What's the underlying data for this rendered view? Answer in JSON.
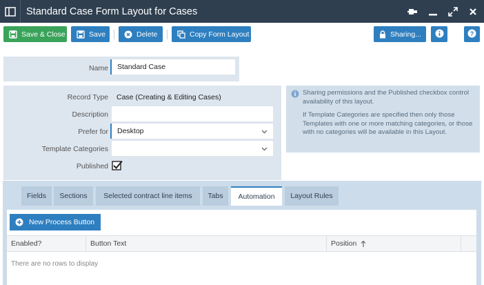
{
  "window": {
    "title": "Standard Case Form Layout for Cases"
  },
  "toolbar": {
    "save_close": "Save & Close",
    "save": "Save",
    "delete": "Delete",
    "copy_form_layout": "Copy Form Layout",
    "sharing": "Sharing..."
  },
  "form": {
    "name_label": "Name",
    "name_value": "Standard Case",
    "record_type_label": "Record Type",
    "record_type_value": "Case (Creating & Editing Cases)",
    "description_label": "Description",
    "description_value": "",
    "prefer_for_label": "Prefer for",
    "prefer_for_value": "Desktop",
    "template_categories_label": "Template Categories",
    "template_categories_value": "",
    "published_label": "Published",
    "published_checked": true
  },
  "info": {
    "line1": "Sharing permissions and the Published checkbox control availability of this layout.",
    "line2": "If Template Categories are specified then only those Templates with one or more matching categories, or those with no categories will be available in this Layout."
  },
  "tabs": [
    {
      "label": "Fields"
    },
    {
      "label": "Sections"
    },
    {
      "label": "Selected contract line items"
    },
    {
      "label": "Tabs"
    },
    {
      "label": "Automation"
    },
    {
      "label": "Layout Rules"
    }
  ],
  "active_tab": "Automation",
  "automation": {
    "new_button": "New Process Button",
    "columns": [
      "Enabled?",
      "Button Text",
      "Position"
    ],
    "empty_text": "There are no rows to display"
  },
  "colors": {
    "titlebar": "#2f3f50",
    "green": "#3aa35a",
    "blue": "#2e7fc0",
    "panel": "#dde5ee"
  }
}
